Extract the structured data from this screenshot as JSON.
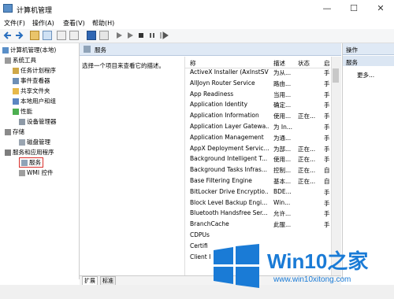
{
  "window": {
    "title": "计算机管理",
    "controls": [
      "—",
      "☐",
      "✕"
    ]
  },
  "menu": [
    "文件(F)",
    "操作(A)",
    "查看(V)",
    "帮助(H)"
  ],
  "tree": {
    "root": "计算机管理(本地)",
    "system_tools": "系统工具",
    "system_items": [
      "任务计划程序",
      "事件查看器",
      "共享文件夹",
      "本地用户和组",
      "性能",
      "设备管理器"
    ],
    "storage": "存储",
    "storage_items": [
      "磁盘管理"
    ],
    "services_apps": "服务和应用程序",
    "services_apps_items": [
      "服务",
      "WMI 控件"
    ]
  },
  "middle": {
    "header": "服务",
    "description": "选择一个项目来查看它的描述。",
    "columns": [
      "称",
      "描述",
      "状态",
      "启"
    ],
    "rows": [
      [
        "ActiveX Installer (AxInstSV)",
        "为从...",
        "",
        "手"
      ],
      [
        "AllJoyn Router Service",
        "路由...",
        "",
        "手"
      ],
      [
        "App Readiness",
        "当用...",
        "",
        "手"
      ],
      [
        "Application Identity",
        "确定...",
        "",
        "手"
      ],
      [
        "Application Information",
        "使用...",
        "正在...",
        "手"
      ],
      [
        "Application Layer Gatewa...",
        "为 In...",
        "",
        "手"
      ],
      [
        "Application Management",
        "为通...",
        "",
        "手"
      ],
      [
        "AppX Deployment Servic...",
        "为部...",
        "正在...",
        "手"
      ],
      [
        "Background Intelligent T...",
        "使用...",
        "正在...",
        "手"
      ],
      [
        "Background Tasks Infras...",
        "控制...",
        "正在...",
        "自"
      ],
      [
        "Base Filtering Engine",
        "基本...",
        "正在...",
        "自"
      ],
      [
        "BitLocker Drive Encryptio...",
        "BDE...",
        "",
        "手"
      ],
      [
        "Block Level Backup Engi...",
        "Win...",
        "",
        "手"
      ],
      [
        "Bluetooth Handsfree Ser...",
        "允许...",
        "",
        "手"
      ],
      [
        "BranchCache",
        "此服...",
        "",
        "手"
      ],
      [
        "CDPUs",
        "",
        "",
        ""
      ],
      [
        "Certifi",
        "",
        "",
        ""
      ],
      [
        "Client I",
        "",
        "",
        ""
      ]
    ]
  },
  "actions": {
    "header": "操作",
    "section": "服务",
    "more": "更多..."
  },
  "bottom_tabs": [
    "扩展",
    "标准"
  ],
  "watermark": {
    "brand": "Win10之家",
    "url": "www.win10xitong.com"
  },
  "colors": {
    "accent": "#1a7bd6",
    "selected_border": "#d9302c",
    "header_bg": "#dfe9f5"
  }
}
